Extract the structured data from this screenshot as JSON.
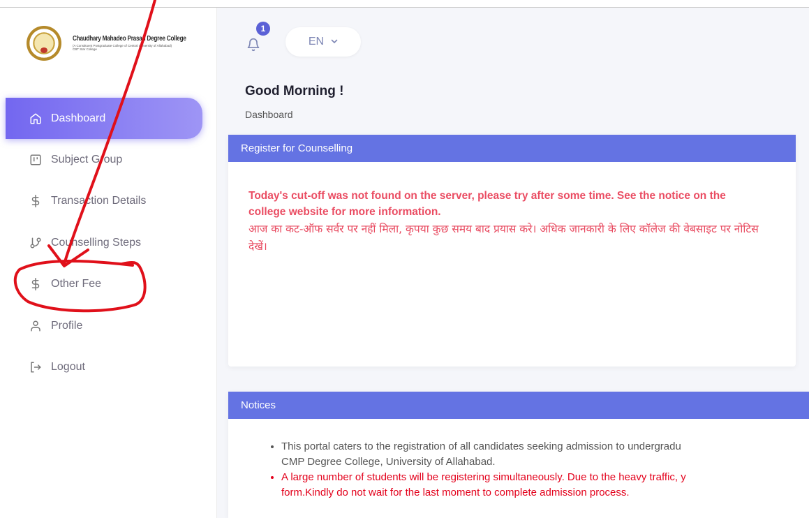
{
  "brand": {
    "name": "Chaudhary Mahadeo Prasad Degree College",
    "sub": "(A Constituent Postgraduate College of Central University of Allahabad)",
    "sub2": "CBT Star College"
  },
  "sidebar": {
    "items": [
      {
        "label": "Dashboard",
        "icon": "home-icon",
        "active": true
      },
      {
        "label": "Subject Group",
        "icon": "kanban-icon",
        "active": false
      },
      {
        "label": "Transaction Details",
        "icon": "dollar-icon",
        "active": false
      },
      {
        "label": "Counselling Steps",
        "icon": "git-branch-icon",
        "active": false
      },
      {
        "label": "Other Fee",
        "icon": "dollar-icon",
        "active": false
      },
      {
        "label": "Profile",
        "icon": "user-icon",
        "active": false
      },
      {
        "label": "Logout",
        "icon": "logout-icon",
        "active": false
      }
    ]
  },
  "topbar": {
    "notification_count": "1",
    "language": "EN"
  },
  "page": {
    "greeting": "Good Morning !",
    "breadcrumb": "Dashboard"
  },
  "counselling": {
    "title": "Register for Counselling",
    "message_en": "Today's cut-off was not found on the server, please try after some time. See the notice on the college website for more information.",
    "message_hi": "आज का कट-ऑफ सर्वर पर नहीं मिला, कृपया कुछ समय बाद प्रयास करे। अधिक जानकारी के लिए कॉलेज की वेबसाइट पर नोटिस देखें।"
  },
  "notices": {
    "title": "Notices",
    "items": [
      {
        "line1": "This portal caters to the registration of all candidates seeking admission to undergradu",
        "line2": "CMP Degree College, University of Allahabad.",
        "style": "normal"
      },
      {
        "line1": "A large number of students will be registering simultaneously. Due to the heavy traffic, y",
        "line2": "form.Kindly do not wait for the last moment to complete admission process.",
        "style": "alert"
      }
    ]
  },
  "colors": {
    "accent": "#7367f0",
    "card_header": "#6473e3",
    "error_text": "#ea4c62",
    "annotation": "#e0101a"
  }
}
